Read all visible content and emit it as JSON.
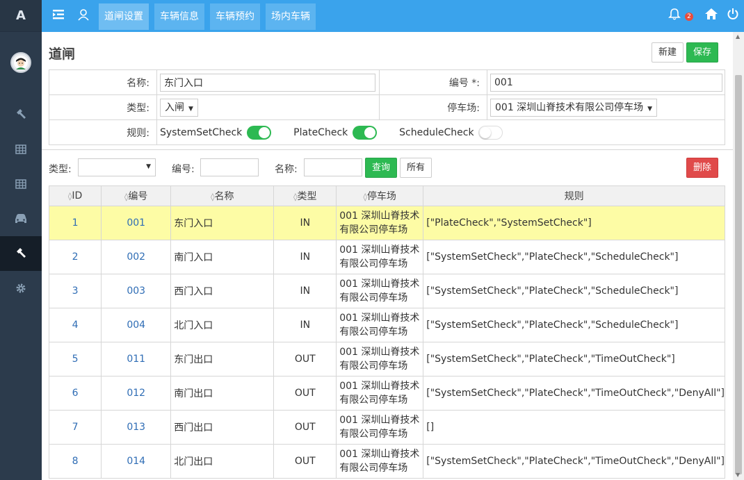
{
  "sidebar": {
    "logo": "A",
    "items": [
      {
        "icon": "hammer-icon"
      },
      {
        "icon": "table-icon"
      },
      {
        "icon": "table-icon"
      },
      {
        "icon": "car-icon"
      },
      {
        "icon": "hammer-icon",
        "active": true
      },
      {
        "icon": "gear-icon"
      }
    ]
  },
  "topbar": {
    "tabs": [
      "道闸设置",
      "车辆信息",
      "车辆预约",
      "场内车辆"
    ],
    "notification_count": "2"
  },
  "page": {
    "title": "道闸",
    "new_button": "新建",
    "save_button": "保存"
  },
  "form": {
    "name_label": "名称:",
    "name_value": "东门入口",
    "code_label": "编号 *:",
    "code_value": "001",
    "type_label": "类型:",
    "type_value": "入闸",
    "lot_label": "停车场:",
    "lot_value": "001 深圳山脊技术有限公司停车场",
    "rules_label": "规则:",
    "rules": [
      {
        "name": "SystemSetCheck",
        "on": true
      },
      {
        "name": "PlateCheck",
        "on": true
      },
      {
        "name": "ScheduleCheck",
        "on": false
      }
    ]
  },
  "filter": {
    "type_label": "类型:",
    "code_label": "编号:",
    "name_label": "名称:",
    "query_button": "查询",
    "all_button": "所有",
    "delete_button": "删除"
  },
  "table": {
    "headers": [
      "ID",
      "编号",
      "名称",
      "类型",
      "停车场",
      "规则"
    ],
    "sort_glyph": "◊",
    "rows": [
      {
        "id": "1",
        "code": "001",
        "name": "东门入口",
        "type": "IN",
        "lot1": "001 深圳山脊技术",
        "lot2": "有限公司停车场",
        "rules": "[\"PlateCheck\",\"SystemSetCheck\"]",
        "selected": true
      },
      {
        "id": "2",
        "code": "002",
        "name": "南门入口",
        "type": "IN",
        "lot1": "001 深圳山脊技术",
        "lot2": "有限公司停车场",
        "rules": "[\"SystemSetCheck\",\"PlateCheck\",\"ScheduleCheck\"]"
      },
      {
        "id": "3",
        "code": "003",
        "name": "西门入口",
        "type": "IN",
        "lot1": "001 深圳山脊技术",
        "lot2": "有限公司停车场",
        "rules": "[\"SystemSetCheck\",\"PlateCheck\",\"ScheduleCheck\"]"
      },
      {
        "id": "4",
        "code": "004",
        "name": "北门入口",
        "type": "IN",
        "lot1": "001 深圳山脊技术",
        "lot2": "有限公司停车场",
        "rules": "[\"SystemSetCheck\",\"PlateCheck\",\"ScheduleCheck\"]"
      },
      {
        "id": "5",
        "code": "011",
        "name": "东门出口",
        "type": "OUT",
        "lot1": "001 深圳山脊技术",
        "lot2": "有限公司停车场",
        "rules": "[\"SystemSetCheck\",\"PlateCheck\",\"TimeOutCheck\"]"
      },
      {
        "id": "6",
        "code": "012",
        "name": "南门出口",
        "type": "OUT",
        "lot1": "001 深圳山脊技术",
        "lot2": "有限公司停车场",
        "rules": "[\"SystemSetCheck\",\"PlateCheck\",\"TimeOutCheck\",\"DenyAll\"]"
      },
      {
        "id": "7",
        "code": "013",
        "name": "西门出口",
        "type": "OUT",
        "lot1": "001 深圳山脊技术",
        "lot2": "有限公司停车场",
        "rules": "[]"
      },
      {
        "id": "8",
        "code": "014",
        "name": "北门出口",
        "type": "OUT",
        "lot1": "001 深圳山脊技术",
        "lot2": "有限公司停车场",
        "rules": "[\"SystemSetCheck\",\"PlateCheck\",\"TimeOutCheck\",\"DenyAll\"]"
      }
    ]
  },
  "colors": {
    "topbar": "#3aa3ec",
    "sidebar": "#2c3b4c",
    "selected_row": "#fdfca5",
    "accent_green": "#2db952",
    "danger_red": "#e04a4a",
    "link_blue": "#2f6db5"
  }
}
